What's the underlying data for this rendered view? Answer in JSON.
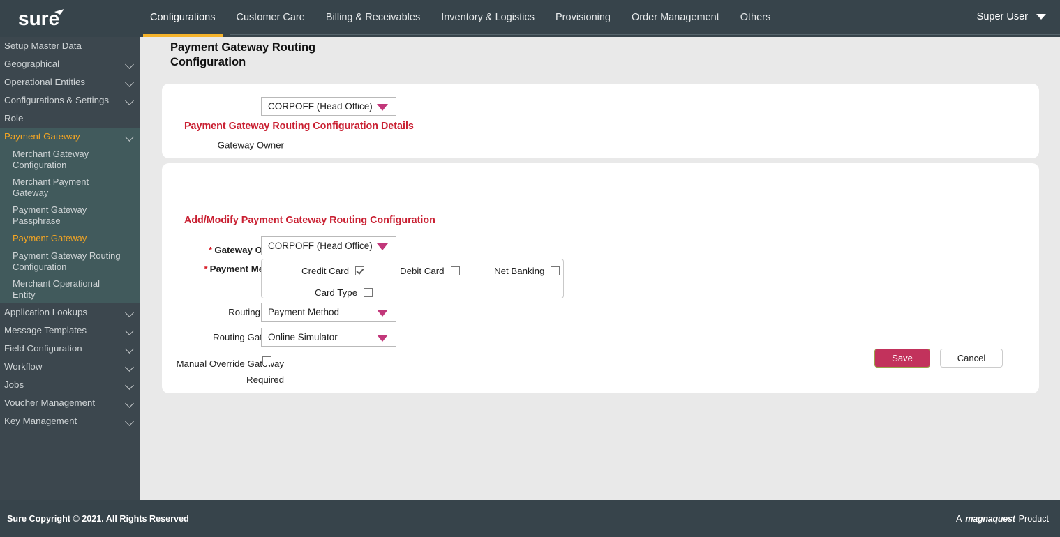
{
  "topbar": {
    "logo_text": "sure",
    "nav_items": [
      {
        "label": "Configurations",
        "active": true
      },
      {
        "label": "Customer Care",
        "active": false
      },
      {
        "label": "Billing & Receivables",
        "active": false
      },
      {
        "label": "Inventory & Logistics",
        "active": false
      },
      {
        "label": "Provisioning",
        "active": false
      },
      {
        "label": "Order Management",
        "active": false
      },
      {
        "label": "Others",
        "active": false
      }
    ],
    "user_label": "Super User",
    "user_caret_icon": "chevron-down-icon"
  },
  "sidebar": {
    "items": [
      {
        "label": "Setup Master Data",
        "chevron": false,
        "state": "normal",
        "sub": false
      },
      {
        "label": "Geographical",
        "chevron": true,
        "state": "normal",
        "sub": false
      },
      {
        "label": "Operational Entities",
        "chevron": true,
        "state": "normal",
        "sub": false
      },
      {
        "label": "Configurations & Settings",
        "chevron": true,
        "state": "normal",
        "sub": false
      },
      {
        "label": "Role",
        "chevron": false,
        "state": "normal",
        "sub": false
      },
      {
        "label": "Payment Gateway",
        "chevron": true,
        "state": "sel-parent",
        "sub": false
      },
      {
        "label": "Merchant Gateway Configuration",
        "chevron": false,
        "state": "sub",
        "sub": true
      },
      {
        "label": "Merchant Payment Gateway",
        "chevron": false,
        "state": "sub",
        "sub": true
      },
      {
        "label": "Payment Gateway Passphrase",
        "chevron": false,
        "state": "sub",
        "sub": true
      },
      {
        "label": "Payment Gateway",
        "chevron": false,
        "state": "sel-sub",
        "sub": true
      },
      {
        "label": "Payment Gateway Routing Configuration",
        "chevron": false,
        "state": "sub",
        "sub": true
      },
      {
        "label": "Merchant Operational Entity",
        "chevron": false,
        "state": "sub",
        "sub": true
      },
      {
        "label": "Application Lookups",
        "chevron": true,
        "state": "normal",
        "sub": false
      },
      {
        "label": "Message Templates",
        "chevron": true,
        "state": "normal",
        "sub": false
      },
      {
        "label": "Field Configuration",
        "chevron": true,
        "state": "normal",
        "sub": false
      },
      {
        "label": "Workflow",
        "chevron": true,
        "state": "normal",
        "sub": false
      },
      {
        "label": "Jobs",
        "chevron": true,
        "state": "normal",
        "sub": false
      },
      {
        "label": "Voucher Management",
        "chevron": true,
        "state": "normal",
        "sub": false
      },
      {
        "label": "Key Management",
        "chevron": true,
        "state": "normal",
        "sub": false
      }
    ]
  },
  "main": {
    "page_title": "Payment Gateway Routing Configuration",
    "top_card": {
      "gateway_owner_label": "Gateway Owner",
      "gateway_owner_value": "CORPOFF (Head Office)",
      "details_heading": "Payment Gateway Routing Configuration Details"
    },
    "form_card": {
      "heading": "Add/Modify Payment Gateway Routing Configuration",
      "gateway_owner_label": "Gateway Owner",
      "gateway_owner_value": "CORPOFF (Head Office)",
      "payment_method_label": "Payment Method",
      "payment_methods": [
        {
          "label": "Credit Card",
          "checked": true
        },
        {
          "label": "Debit Card",
          "checked": false
        },
        {
          "label": "Net Banking",
          "checked": false
        },
        {
          "label": "Card Type",
          "checked": false
        }
      ],
      "routing_point_label": "Routing Point",
      "routing_point_value": "Payment Method",
      "routing_gateway_label": "Routing Gateway",
      "routing_gateway_value": "Online Simulator",
      "manual_override_label": "Manual Override Gateway Required",
      "manual_override_checked": false,
      "required_marker": "*"
    },
    "buttons": {
      "save_label": "Save",
      "cancel_label": "Cancel"
    }
  },
  "footer": {
    "copyright": "Sure Copyright © 2021. All Rights Reserved",
    "product_prefix": "A",
    "product_brand": "magnaquest",
    "product_suffix": "Product"
  },
  "colors": {
    "header_bg": "#37444b",
    "sidebar_bg": "#3c474e",
    "sidebar_active_bg": "#415a5c",
    "accent_orange": "#f5a623",
    "accent_red": "#c92032",
    "caret_pink": "#c2377a",
    "save_bg": "#c2325c",
    "page_bg": "#e9e9e9"
  }
}
